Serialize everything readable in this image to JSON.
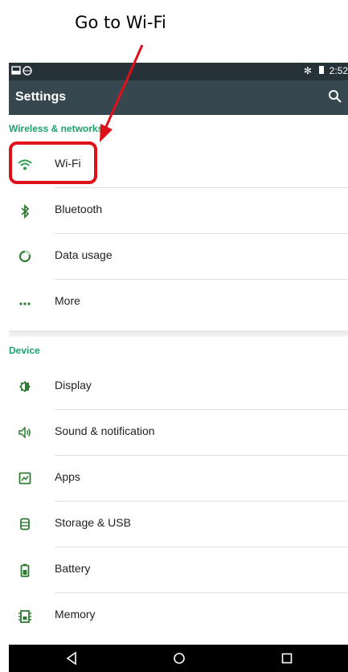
{
  "annotation": {
    "instruction": "Go to Wi-Fi",
    "color": "#e0101a"
  },
  "status_bar": {
    "time": "2:52",
    "battery": "full"
  },
  "app_bar": {
    "title": "Settings"
  },
  "sections": [
    {
      "title": "Wireless & networks",
      "items": [
        {
          "label": "Wi-Fi",
          "icon": "wifi-icon"
        },
        {
          "label": "Bluetooth",
          "icon": "bluetooth-icon"
        },
        {
          "label": "Data usage",
          "icon": "data-usage-icon"
        },
        {
          "label": "More",
          "icon": "more-icon"
        }
      ]
    },
    {
      "title": "Device",
      "items": [
        {
          "label": "Display",
          "icon": "display-icon"
        },
        {
          "label": "Sound & notification",
          "icon": "sound-icon"
        },
        {
          "label": "Apps",
          "icon": "apps-icon"
        },
        {
          "label": "Storage & USB",
          "icon": "storage-icon"
        },
        {
          "label": "Battery",
          "icon": "battery-icon"
        },
        {
          "label": "Memory",
          "icon": "memory-icon"
        }
      ]
    }
  ],
  "colors": {
    "accent": "#1aa36a",
    "icon": "#2e7d32",
    "appbar": "#37474f",
    "statusbar": "#263238"
  }
}
